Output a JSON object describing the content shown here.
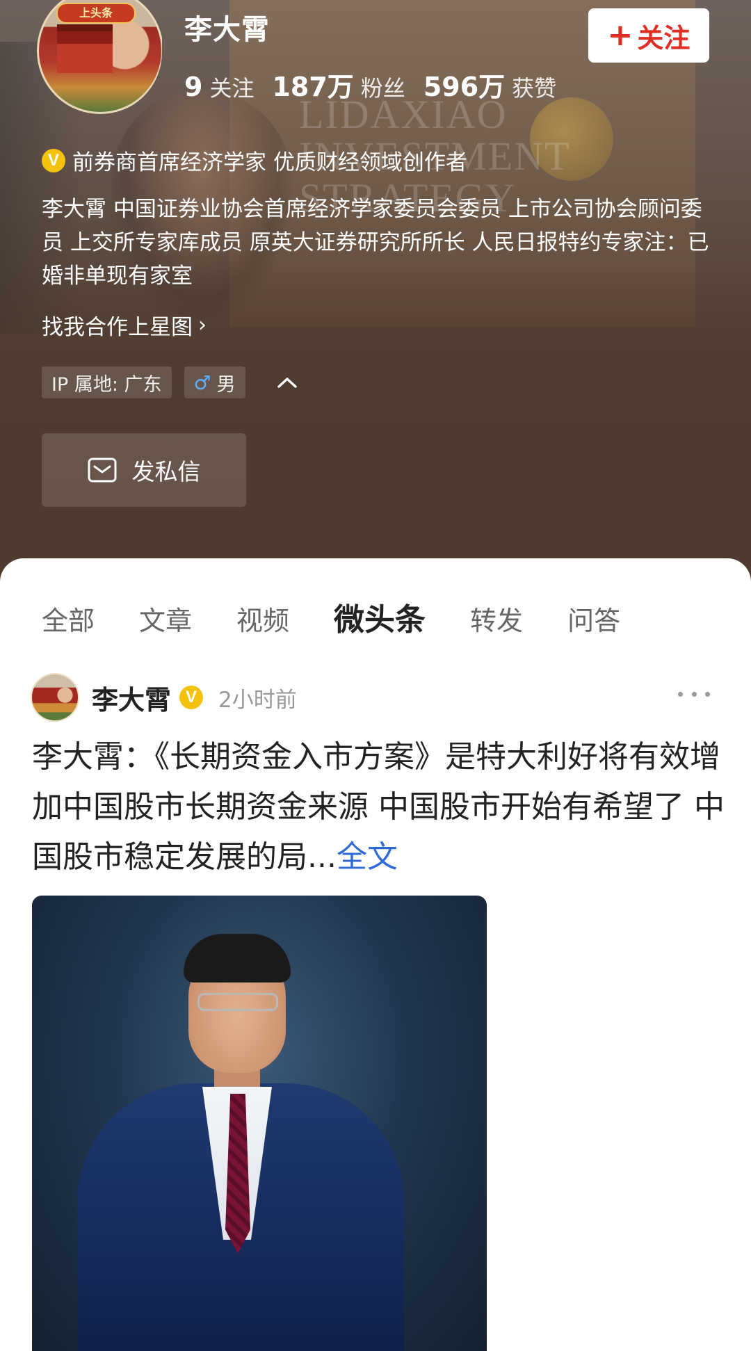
{
  "profile": {
    "name": "李大霄",
    "avatar_banner": "上头条",
    "following_count": "9",
    "following_label": "关注",
    "followers_count": "187万",
    "followers_label": "粉丝",
    "likes_count": "596万",
    "likes_label": "获赞",
    "follow_button_plus": "+",
    "follow_button_label": "关注",
    "verified_badge": "V",
    "verification": "前券商首席经济学家 优质财经领域创作者",
    "bio": "李大霄 中国证券业协会首席经济学家委员会委员 上市公司协会顾问委员 上交所专家库成员 原英大证券研究所所长 人民日报特约专家注：已婚非单现有家室",
    "cooperation_link": "找我合作上星图",
    "cooperation_chevron": "›",
    "ip_location": "IP 属地: 广东",
    "gender_icon": "♂",
    "gender": "男",
    "collapse_icon": "chevron-up-icon",
    "message_icon": "mail-icon",
    "message_button": "发私信"
  },
  "background_text": "LIDAXIAO INVESTMENT STRATEGY",
  "tabs": [
    {
      "label": "全部",
      "active": false
    },
    {
      "label": "文章",
      "active": false
    },
    {
      "label": "视频",
      "active": false
    },
    {
      "label": "微头条",
      "active": true
    },
    {
      "label": "转发",
      "active": false
    },
    {
      "label": "问答",
      "active": false
    }
  ],
  "post": {
    "author": "李大霄",
    "verified_badge": "V",
    "time": "2小时前",
    "text": "李大霄：《长期资金入市方案》是特大利好将有效增加中国股市长期资金来源 中国股市开始有希望了 中国股市稳定发展的局...",
    "read_more": "全文",
    "more_icon": "more-dots-icon"
  },
  "colors": {
    "follow_red": "#e02e24",
    "verified_gold": "#f4c20d",
    "link_blue": "#2f6bd5",
    "header_bg": "#4e3a2e"
  }
}
